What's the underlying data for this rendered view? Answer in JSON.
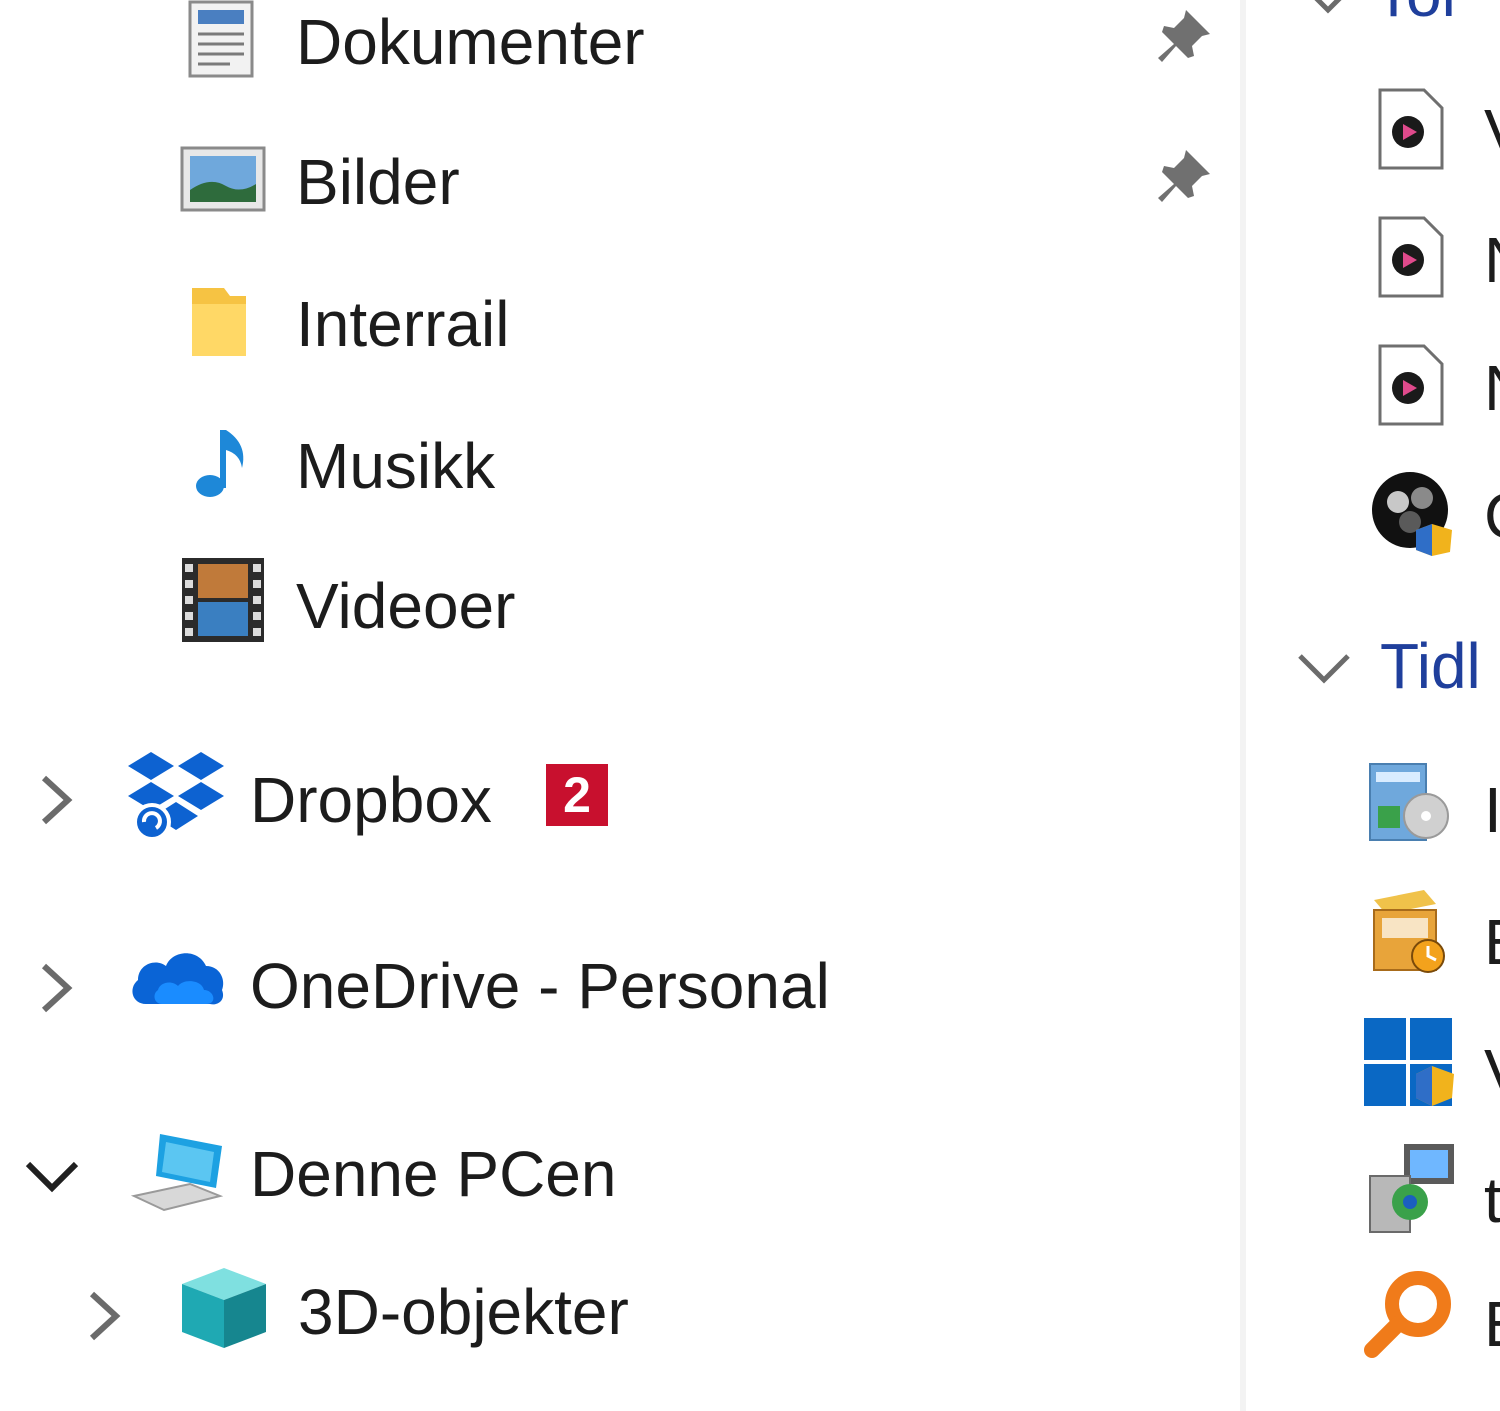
{
  "navigation": {
    "quick_access": [
      {
        "label": "Dokumenter",
        "icon": "documents-icon",
        "pinned": true
      },
      {
        "label": "Bilder",
        "icon": "pictures-icon",
        "pinned": true
      },
      {
        "label": "Interrail",
        "icon": "folder-icon",
        "pinned": false
      },
      {
        "label": "Musikk",
        "icon": "music-icon",
        "pinned": false
      },
      {
        "label": "Videoer",
        "icon": "videos-icon",
        "pinned": false
      }
    ],
    "dropbox": {
      "label": "Dropbox",
      "badge": "2",
      "icon": "dropbox-icon",
      "expanded": false
    },
    "onedrive": {
      "label": "OneDrive - Personal",
      "icon": "onedrive-cloud-icon",
      "expanded": false
    },
    "this_pc": {
      "label": "Denne PCen",
      "icon": "computer-icon",
      "expanded": true
    },
    "objects_3d": {
      "label": "3D-objekter",
      "icon": "3d-objects-icon",
      "expanded": false
    }
  },
  "content": {
    "section_top_label": "Tol",
    "section_top_files": [
      {
        "label": "V",
        "icon": "media-file-icon"
      },
      {
        "label": "N",
        "icon": "media-file-icon"
      },
      {
        "label": "N",
        "icon": "media-file-icon"
      },
      {
        "label": "C",
        "icon": "obs-app-icon"
      }
    ],
    "section_recent_label": "Tidl",
    "section_recent_files": [
      {
        "label": "I",
        "icon": "installer-icon"
      },
      {
        "label": "E",
        "icon": "setup-box-icon"
      },
      {
        "label": "V",
        "icon": "windows-shield-icon"
      },
      {
        "label": "t",
        "icon": "setup-computer-icon"
      },
      {
        "label": "E",
        "icon": "search-orange-icon"
      }
    ]
  },
  "colors": {
    "badge": "#c8102e",
    "section_header": "#1f3f9c",
    "divider": "#f3f3f3"
  }
}
